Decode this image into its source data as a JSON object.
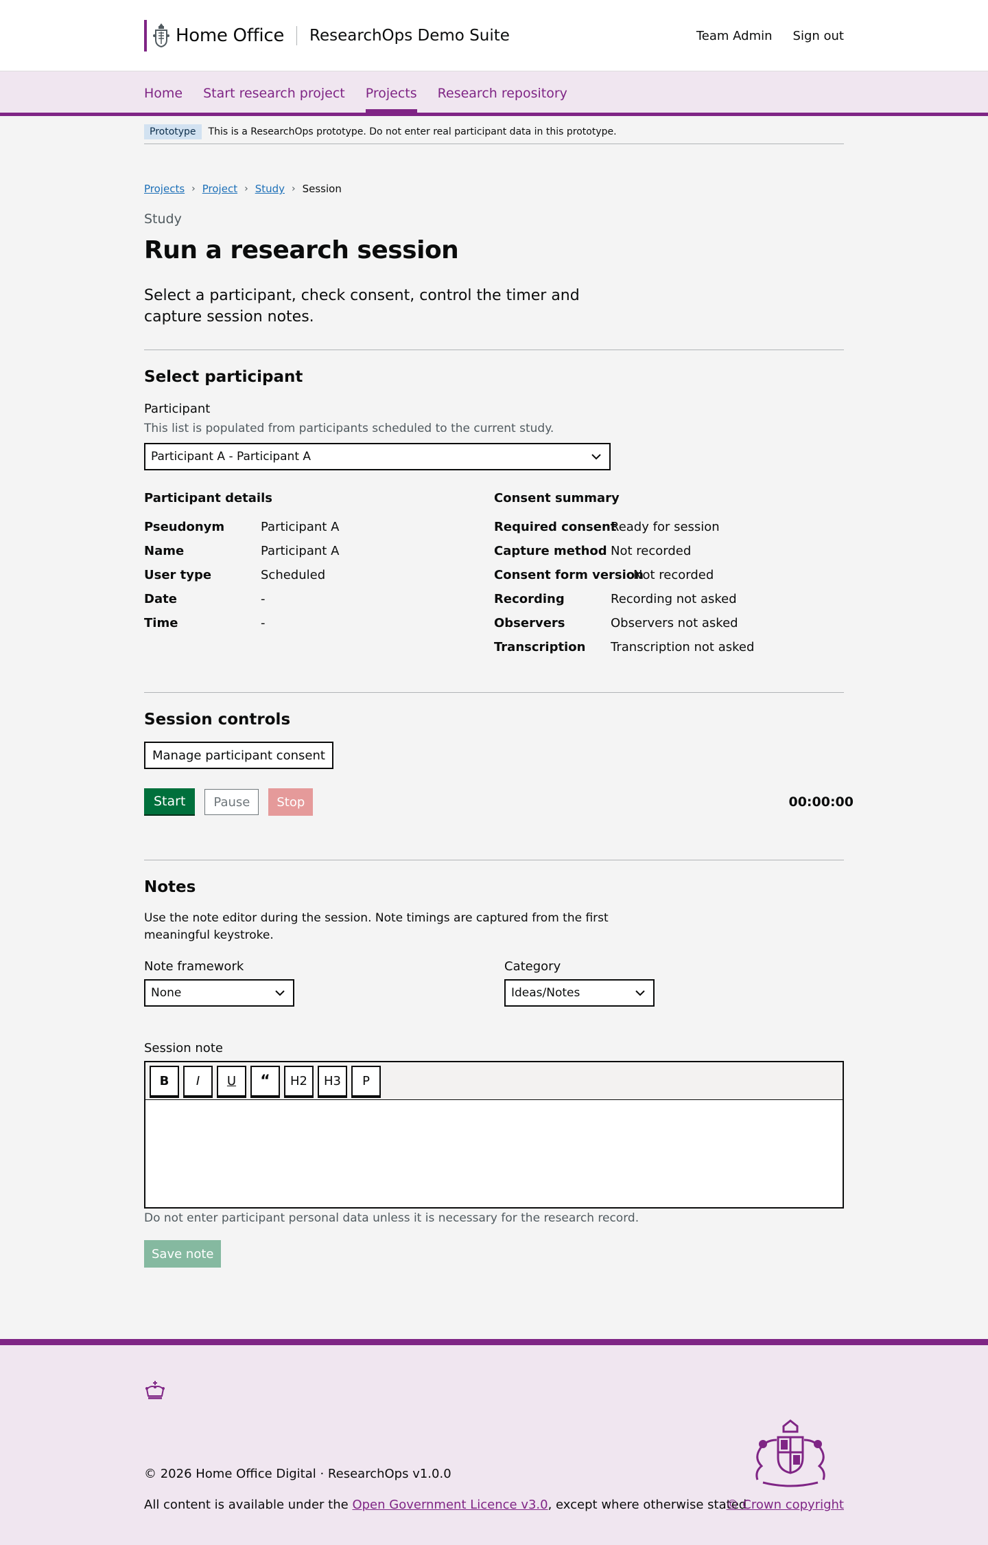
{
  "header": {
    "brand": "Home Office",
    "service": "ResearchOps Demo Suite",
    "links": [
      "Team Admin",
      "Sign out"
    ]
  },
  "nav": {
    "items": [
      "Home",
      "Start research project",
      "Projects",
      "Research repository"
    ],
    "active": "Projects"
  },
  "phase": {
    "tag": "Prototype",
    "text": "This is a ResearchOps prototype. Do not enter real participant data in this prototype."
  },
  "breadcrumb": {
    "items": [
      "Projects",
      "Project",
      "Study"
    ],
    "current": "Session"
  },
  "page": {
    "caption": "Study",
    "title": "Run a research session",
    "lead": "Select a participant, check consent, control the timer and capture session notes."
  },
  "participant": {
    "heading": "Select participant",
    "label": "Participant",
    "hint": "This list is populated from participants scheduled to the current study.",
    "selected": "Participant A - Participant A"
  },
  "details": {
    "heading": "Participant details",
    "rows": [
      {
        "k": "Pseudonym",
        "v": "Participant A"
      },
      {
        "k": "Name",
        "v": "Participant A"
      },
      {
        "k": "User type",
        "v": "Scheduled"
      },
      {
        "k": "Date",
        "v": "-"
      },
      {
        "k": "Time",
        "v": "-"
      }
    ]
  },
  "consent": {
    "heading": "Consent summary",
    "rows": [
      {
        "k": "Required consent",
        "v": "Ready for session"
      },
      {
        "k": "Capture method",
        "v": "Not recorded"
      },
      {
        "k": "Consent form version",
        "v": "Not recorded"
      },
      {
        "k": "Recording",
        "v": "Recording not asked"
      },
      {
        "k": "Observers",
        "v": "Observers not asked"
      },
      {
        "k": "Transcription",
        "v": "Transcription not asked"
      }
    ]
  },
  "controls": {
    "heading": "Session controls",
    "manage": "Manage participant consent",
    "start": "Start",
    "pause": "Pause",
    "stop": "Stop",
    "timer": "00:00:00"
  },
  "notes": {
    "heading": "Notes",
    "intro": "Use the note editor during the session. Note timings are captured from the first meaningful keystroke.",
    "framework_label": "Note framework",
    "framework_value": "None",
    "category_label": "Category",
    "category_value": "Ideas/Notes",
    "session_label": "Session note",
    "toolbar": [
      "B",
      "I",
      "U",
      "“",
      "H2",
      "H3",
      "P"
    ],
    "warning": "Do not enter participant personal data unless it is necessary for the research record.",
    "save": "Save note"
  },
  "footer": {
    "copyright": "© 2026 Home Office Digital · ResearchOps v1.0.0",
    "licence_pre": "All content is available under the ",
    "licence_link": "Open Government Licence v3.0",
    "licence_post": ", except where otherwise stated",
    "crown": "© Crown copyright"
  },
  "colors": {
    "brand": "#7f2585",
    "link": "#1d70b8",
    "start": "#00703c",
    "stop": "#e59a9a",
    "save": "#85b9a0"
  }
}
